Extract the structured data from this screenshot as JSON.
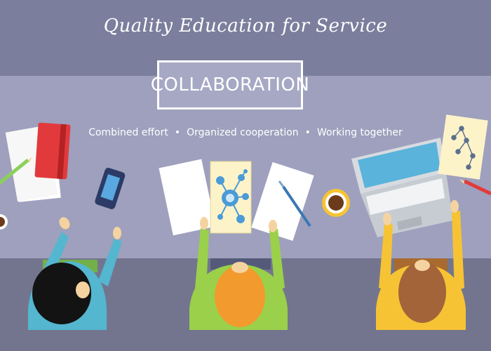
{
  "header": {
    "title": "Quality Education for Service"
  },
  "label": {
    "text": "COLLABORATION"
  },
  "subtitle": {
    "items": [
      "Combined effort",
      "Organized cooperation",
      "Working together"
    ],
    "separator": "•"
  },
  "colors": {
    "background": "#7b7e9c",
    "accent_red": "#e23a3c",
    "shirt_blue": "#54b6cf",
    "shirt_green": "#9bd04a",
    "shirt_yellow": "#f6c334"
  }
}
